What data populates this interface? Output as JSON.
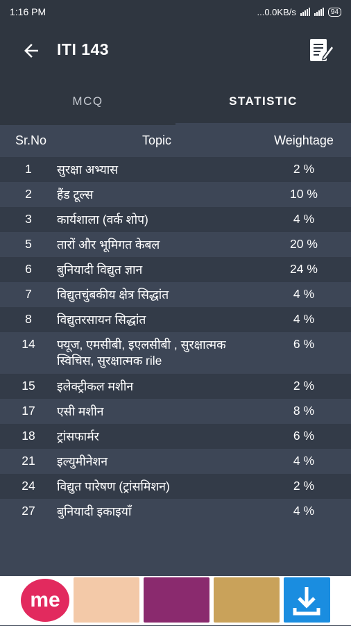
{
  "status": {
    "time": "1:16 PM",
    "net": "...0.0KB/s",
    "battery": "94"
  },
  "toolbar": {
    "title": "ITI 143"
  },
  "tabs": [
    {
      "label": "MCQ"
    },
    {
      "label": "STATISTIC"
    }
  ],
  "table": {
    "headers": {
      "no": "Sr.No",
      "topic": "Topic",
      "weight": "Weightage"
    },
    "rows": [
      {
        "no": "1",
        "topic": "सुरक्षा अभ्यास",
        "weight": "2 %"
      },
      {
        "no": "2",
        "topic": "हैंड टूल्स",
        "weight": "10 %"
      },
      {
        "no": "3",
        "topic": "कार्यशाला (वर्क शोप)",
        "weight": "4 %"
      },
      {
        "no": "5",
        "topic": "तारों और भूमिगत केबल",
        "weight": "20 %"
      },
      {
        "no": "6",
        "topic": "बुनियादी विद्युत ज्ञान",
        "weight": "24 %"
      },
      {
        "no": "7",
        "topic": "विद्युतचुंबकीय क्षेत्र सिद्धांत",
        "weight": "4 %"
      },
      {
        "no": "8",
        "topic": "विद्युतरसायन सिद्धांत",
        "weight": "4 %"
      },
      {
        "no": "14",
        "topic": "फ्यूज, एमसीबी, इएलसीबी , सुरक्षात्मक स्विचिस, सुरक्षात्मक rile",
        "weight": "6 %"
      },
      {
        "no": "15",
        "topic": "इलेक्ट्रीकल मशीन",
        "weight": "2 %"
      },
      {
        "no": "17",
        "topic": "एसी मशीन",
        "weight": "8 %"
      },
      {
        "no": "18",
        "topic": "ट्रांसफार्मर",
        "weight": "6 %"
      },
      {
        "no": "21",
        "topic": "इल्युमीनेशन",
        "weight": "4 %"
      },
      {
        "no": "24",
        "topic": "विद्युत पारेषण (ट्रांसमिशन)",
        "weight": "2 %"
      },
      {
        "no": "27",
        "topic": "बुनियादी इकाइयाँ",
        "weight": "4 %"
      }
    ]
  },
  "ad": {
    "logo": "me"
  }
}
